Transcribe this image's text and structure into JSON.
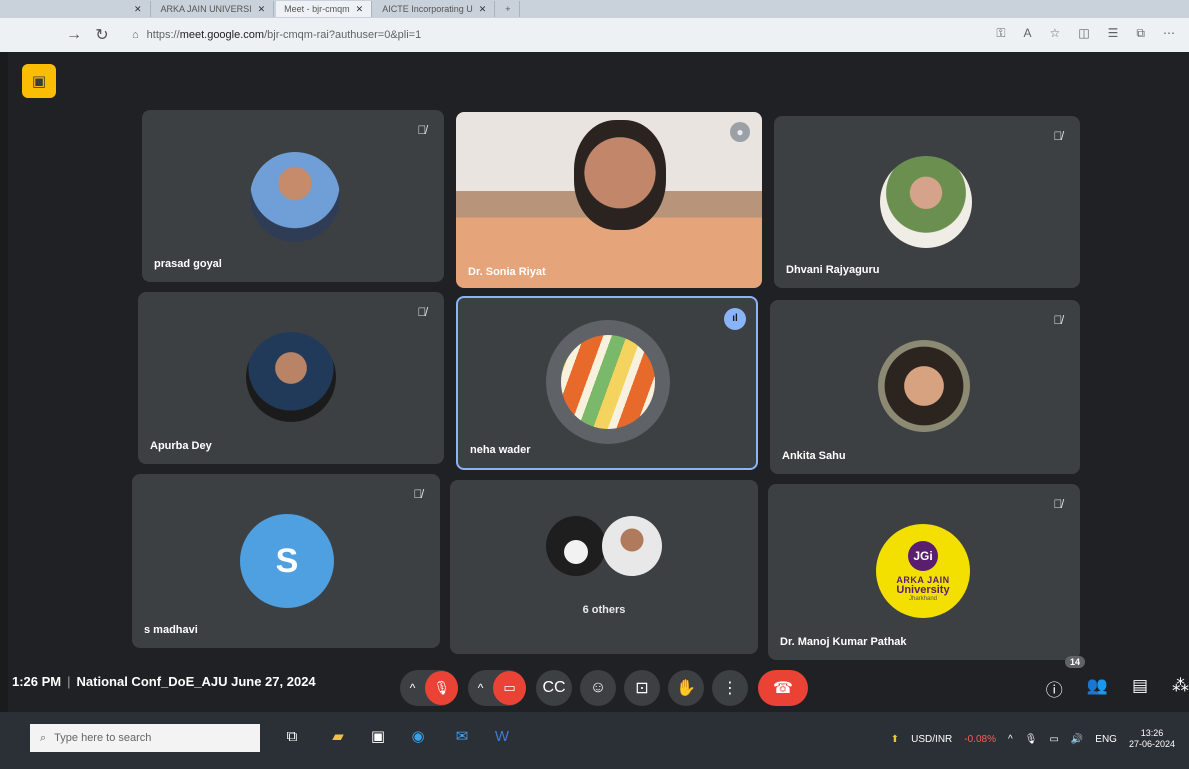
{
  "browser": {
    "tabs": [
      {
        "label": "",
        "active": false
      },
      {
        "label": "ARKA JAIN UNIVERSI",
        "active": false
      },
      {
        "label": "Meet - bjr-cmqm",
        "active": true
      },
      {
        "label": "AICTE Incorporating U",
        "active": false
      }
    ],
    "url_prefix": "https://",
    "url_domain": "meet.google.com",
    "url_path": "/bjr-cmqm-rai?authuser=0&pli=1"
  },
  "participants": [
    {
      "name": "prasad goyal",
      "muted": true
    },
    {
      "name": "Dr. Sonia Riyat",
      "muted": false
    },
    {
      "name": "Dhvani Rajyaguru",
      "muted": true
    },
    {
      "name": "Apurba Dey",
      "muted": true
    },
    {
      "name": "neha wader",
      "speaking": true
    },
    {
      "name": "Ankita Sahu",
      "muted": true
    },
    {
      "name": "s madhavi",
      "muted": true,
      "initial": "S"
    },
    {
      "name": "6 others"
    },
    {
      "name": "Dr. Manoj Kumar Pathak",
      "muted": true
    }
  ],
  "logo": {
    "mark": "JGi",
    "line1": "ARKA JAIN",
    "line2": "University",
    "line3": "Jharkhand"
  },
  "meeting": {
    "time": "1:26 PM",
    "title": "National Conf_DoE_AJU June 27, 2024",
    "people_count": "14"
  },
  "taskbar": {
    "search_placeholder": "Type here to search",
    "ticker": "USD/INR",
    "ticker_change": "-0.08%",
    "lang": "ENG",
    "time": "13:26",
    "date": "27-06-2024"
  },
  "colors": {
    "meet_bg": "#202124",
    "tile_bg": "#3c4043",
    "end_call": "#ea4335",
    "speaking_border": "#8ab4f8"
  }
}
